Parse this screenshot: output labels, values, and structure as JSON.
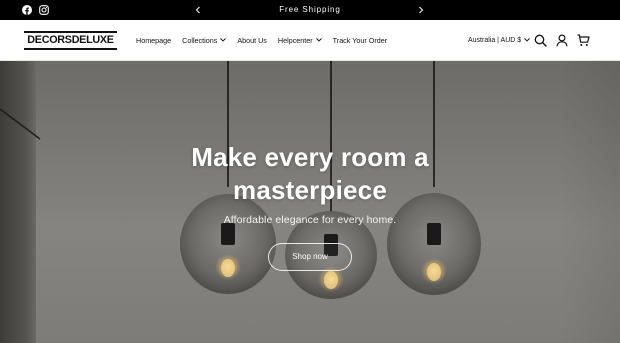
{
  "announcement": {
    "message": "Free Shipping",
    "social_icons": [
      "facebook-icon",
      "instagram-icon"
    ],
    "prev_icon": "chevron-left-icon",
    "next_icon": "chevron-right-icon"
  },
  "header": {
    "logo": "DECORSDELUXE",
    "nav": [
      {
        "label": "Homepage",
        "dropdown": false
      },
      {
        "label": "Collections",
        "dropdown": true
      },
      {
        "label": "About Us",
        "dropdown": false
      },
      {
        "label": "Helpcenter",
        "dropdown": true
      },
      {
        "label": "Track Your Order",
        "dropdown": false
      }
    ],
    "locale": "Australia | AUD $",
    "icons": [
      "search-icon",
      "account-icon",
      "cart-icon"
    ]
  },
  "hero": {
    "title_line1": "Make every room a",
    "title_line2": "masterpiece",
    "subtitle": "Affordable elegance for every home.",
    "cta": "Shop now"
  },
  "colors": {
    "announcement_bg": "#000000",
    "header_bg": "#ffffff",
    "text": "#111111",
    "hero_text": "#ffffff"
  }
}
